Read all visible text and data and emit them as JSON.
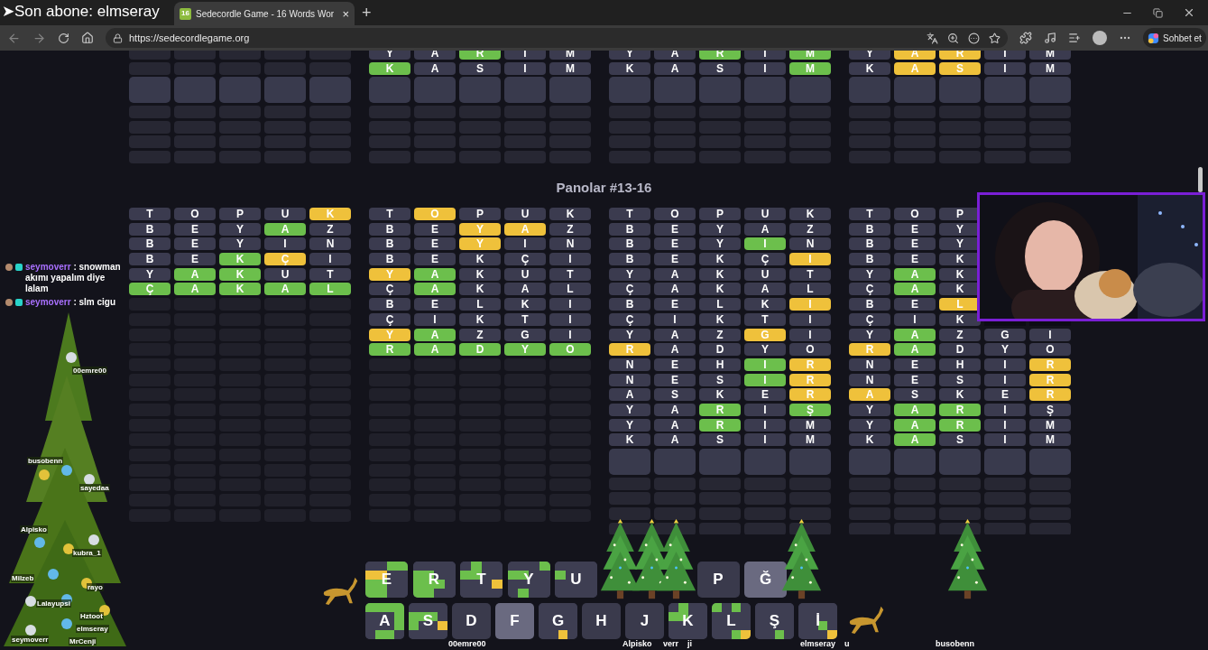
{
  "overlay": {
    "arrow": "➤",
    "text": "Son abone: elmseray"
  },
  "browser": {
    "tabs": [
      {
        "icon": "16",
        "title": "Sedecordle Game - 16 Words Wor",
        "close": "×",
        "selected": true
      }
    ],
    "new_tab": "+",
    "url": "https://sedecordlegame.org",
    "copilot": "Sohbet et"
  },
  "top_boards": [
    {
      "solved": false
    },
    {
      "solved": false,
      "rows": [
        [
          {
            "letter": "Y",
            "color": "#3b3b4f"
          },
          {
            "letter": "A",
            "color": "#3b3b4f"
          },
          {
            "letter": "R",
            "color": "#6cbf4c"
          },
          {
            "letter": "I",
            "color": "#3b3b4f"
          },
          {
            "letter": "M",
            "color": "#3b3b4f"
          }
        ],
        [
          {
            "letter": "K",
            "color": "#6cbf4c"
          },
          {
            "letter": "A",
            "color": "#3b3b4f"
          },
          {
            "letter": "S",
            "color": "#3b3b4f"
          },
          {
            "letter": "I",
            "color": "#3b3b4f"
          },
          {
            "letter": "M",
            "color": "#3b3b4f"
          }
        ]
      ]
    },
    {
      "solved": false,
      "rows": [
        [
          {
            "letter": "Y",
            "color": "#3b3b4f"
          },
          {
            "letter": "A",
            "color": "#3b3b4f"
          },
          {
            "letter": "R",
            "color": "#6cbf4c"
          },
          {
            "letter": "I",
            "color": "#3b3b4f"
          },
          {
            "letter": "M",
            "color": "#6cbf4c"
          }
        ],
        [
          {
            "letter": "K",
            "color": "#3b3b4f"
          },
          {
            "letter": "A",
            "color": "#3b3b4f"
          },
          {
            "letter": "S",
            "color": "#3b3b4f"
          },
          {
            "letter": "I",
            "color": "#3b3b4f"
          },
          {
            "letter": "M",
            "color": "#6cbf4c"
          }
        ]
      ]
    },
    {
      "solved": false,
      "rows": [
        [
          {
            "letter": "Y",
            "color": "#3b3b4f"
          },
          {
            "letter": "A",
            "color": "#efc13b"
          },
          {
            "letter": "R",
            "color": "#efc13b"
          },
          {
            "letter": "I",
            "color": "#3b3b4f"
          },
          {
            "letter": "M",
            "color": "#3b3b4f"
          }
        ],
        [
          {
            "letter": "K",
            "color": "#3b3b4f"
          },
          {
            "letter": "A",
            "color": "#efc13b"
          },
          {
            "letter": "S",
            "color": "#efc13b"
          },
          {
            "letter": "I",
            "color": "#3b3b4f"
          },
          {
            "letter": "M",
            "color": "#3b3b4f"
          }
        ]
      ]
    }
  ],
  "heading": "Panolar #13-16",
  "boards": [
    {
      "solved": true,
      "rows": [
        [
          {
            "letter": "T",
            "color": "#3b3b4f"
          },
          {
            "letter": "O",
            "color": "#3b3b4f"
          },
          {
            "letter": "P",
            "color": "#3b3b4f"
          },
          {
            "letter": "U",
            "color": "#3b3b4f"
          },
          {
            "letter": "K",
            "color": "#efc13b"
          }
        ],
        [
          {
            "letter": "B",
            "color": "#3b3b4f"
          },
          {
            "letter": "E",
            "color": "#3b3b4f"
          },
          {
            "letter": "Y",
            "color": "#3b3b4f"
          },
          {
            "letter": "A",
            "color": "#6cbf4c"
          },
          {
            "letter": "Z",
            "color": "#3b3b4f"
          }
        ],
        [
          {
            "letter": "B",
            "color": "#3b3b4f"
          },
          {
            "letter": "E",
            "color": "#3b3b4f"
          },
          {
            "letter": "Y",
            "color": "#3b3b4f"
          },
          {
            "letter": "I",
            "color": "#3b3b4f"
          },
          {
            "letter": "N",
            "color": "#3b3b4f"
          }
        ],
        [
          {
            "letter": "B",
            "color": "#3b3b4f"
          },
          {
            "letter": "E",
            "color": "#3b3b4f"
          },
          {
            "letter": "K",
            "color": "#6cbf4c"
          },
          {
            "letter": "Ç",
            "color": "#efc13b"
          },
          {
            "letter": "I",
            "color": "#3b3b4f"
          }
        ],
        [
          {
            "letter": "Y",
            "color": "#3b3b4f"
          },
          {
            "letter": "A",
            "color": "#6cbf4c"
          },
          {
            "letter": "K",
            "color": "#6cbf4c"
          },
          {
            "letter": "U",
            "color": "#3b3b4f"
          },
          {
            "letter": "T",
            "color": "#3b3b4f"
          }
        ],
        [
          {
            "letter": "Ç",
            "color": "#6cbf4c"
          },
          {
            "letter": "A",
            "color": "#6cbf4c"
          },
          {
            "letter": "K",
            "color": "#6cbf4c"
          },
          {
            "letter": "A",
            "color": "#6cbf4c"
          },
          {
            "letter": "L",
            "color": "#6cbf4c"
          }
        ]
      ]
    },
    {
      "solved": true,
      "rows": [
        [
          {
            "letter": "T",
            "color": "#3b3b4f"
          },
          {
            "letter": "O",
            "color": "#efc13b"
          },
          {
            "letter": "P",
            "color": "#3b3b4f"
          },
          {
            "letter": "U",
            "color": "#3b3b4f"
          },
          {
            "letter": "K",
            "color": "#3b3b4f"
          }
        ],
        [
          {
            "letter": "B",
            "color": "#3b3b4f"
          },
          {
            "letter": "E",
            "color": "#3b3b4f"
          },
          {
            "letter": "Y",
            "color": "#efc13b"
          },
          {
            "letter": "A",
            "color": "#efc13b"
          },
          {
            "letter": "Z",
            "color": "#3b3b4f"
          }
        ],
        [
          {
            "letter": "B",
            "color": "#3b3b4f"
          },
          {
            "letter": "E",
            "color": "#3b3b4f"
          },
          {
            "letter": "Y",
            "color": "#efc13b"
          },
          {
            "letter": "I",
            "color": "#3b3b4f"
          },
          {
            "letter": "N",
            "color": "#3b3b4f"
          }
        ],
        [
          {
            "letter": "B",
            "color": "#3b3b4f"
          },
          {
            "letter": "E",
            "color": "#3b3b4f"
          },
          {
            "letter": "K",
            "color": "#3b3b4f"
          },
          {
            "letter": "Ç",
            "color": "#3b3b4f"
          },
          {
            "letter": "I",
            "color": "#3b3b4f"
          }
        ],
        [
          {
            "letter": "Y",
            "color": "#efc13b"
          },
          {
            "letter": "A",
            "color": "#6cbf4c"
          },
          {
            "letter": "K",
            "color": "#3b3b4f"
          },
          {
            "letter": "U",
            "color": "#3b3b4f"
          },
          {
            "letter": "T",
            "color": "#3b3b4f"
          }
        ],
        [
          {
            "letter": "Ç",
            "color": "#3b3b4f"
          },
          {
            "letter": "A",
            "color": "#6cbf4c"
          },
          {
            "letter": "K",
            "color": "#3b3b4f"
          },
          {
            "letter": "A",
            "color": "#3b3b4f"
          },
          {
            "letter": "L",
            "color": "#3b3b4f"
          }
        ],
        [
          {
            "letter": "B",
            "color": "#3b3b4f"
          },
          {
            "letter": "E",
            "color": "#3b3b4f"
          },
          {
            "letter": "L",
            "color": "#3b3b4f"
          },
          {
            "letter": "K",
            "color": "#3b3b4f"
          },
          {
            "letter": "I",
            "color": "#3b3b4f"
          }
        ],
        [
          {
            "letter": "Ç",
            "color": "#3b3b4f"
          },
          {
            "letter": "I",
            "color": "#3b3b4f"
          },
          {
            "letter": "K",
            "color": "#3b3b4f"
          },
          {
            "letter": "T",
            "color": "#3b3b4f"
          },
          {
            "letter": "I",
            "color": "#3b3b4f"
          }
        ],
        [
          {
            "letter": "Y",
            "color": "#efc13b"
          },
          {
            "letter": "A",
            "color": "#6cbf4c"
          },
          {
            "letter": "Z",
            "color": "#3b3b4f"
          },
          {
            "letter": "G",
            "color": "#3b3b4f"
          },
          {
            "letter": "I",
            "color": "#3b3b4f"
          }
        ],
        [
          {
            "letter": "R",
            "color": "#6cbf4c"
          },
          {
            "letter": "A",
            "color": "#6cbf4c"
          },
          {
            "letter": "D",
            "color": "#6cbf4c"
          },
          {
            "letter": "Y",
            "color": "#6cbf4c"
          },
          {
            "letter": "O",
            "color": "#6cbf4c"
          }
        ]
      ]
    },
    {
      "solved": false,
      "rows": [
        [
          {
            "letter": "T",
            "color": "#3b3b4f"
          },
          {
            "letter": "O",
            "color": "#3b3b4f"
          },
          {
            "letter": "P",
            "color": "#3b3b4f"
          },
          {
            "letter": "U",
            "color": "#3b3b4f"
          },
          {
            "letter": "K",
            "color": "#3b3b4f"
          }
        ],
        [
          {
            "letter": "B",
            "color": "#3b3b4f"
          },
          {
            "letter": "E",
            "color": "#3b3b4f"
          },
          {
            "letter": "Y",
            "color": "#3b3b4f"
          },
          {
            "letter": "A",
            "color": "#3b3b4f"
          },
          {
            "letter": "Z",
            "color": "#3b3b4f"
          }
        ],
        [
          {
            "letter": "B",
            "color": "#3b3b4f"
          },
          {
            "letter": "E",
            "color": "#3b3b4f"
          },
          {
            "letter": "Y",
            "color": "#3b3b4f"
          },
          {
            "letter": "I",
            "color": "#6cbf4c"
          },
          {
            "letter": "N",
            "color": "#3b3b4f"
          }
        ],
        [
          {
            "letter": "B",
            "color": "#3b3b4f"
          },
          {
            "letter": "E",
            "color": "#3b3b4f"
          },
          {
            "letter": "K",
            "color": "#3b3b4f"
          },
          {
            "letter": "Ç",
            "color": "#3b3b4f"
          },
          {
            "letter": "I",
            "color": "#efc13b"
          }
        ],
        [
          {
            "letter": "Y",
            "color": "#3b3b4f"
          },
          {
            "letter": "A",
            "color": "#3b3b4f"
          },
          {
            "letter": "K",
            "color": "#3b3b4f"
          },
          {
            "letter": "U",
            "color": "#3b3b4f"
          },
          {
            "letter": "T",
            "color": "#3b3b4f"
          }
        ],
        [
          {
            "letter": "Ç",
            "color": "#3b3b4f"
          },
          {
            "letter": "A",
            "color": "#3b3b4f"
          },
          {
            "letter": "K",
            "color": "#3b3b4f"
          },
          {
            "letter": "A",
            "color": "#3b3b4f"
          },
          {
            "letter": "L",
            "color": "#3b3b4f"
          }
        ],
        [
          {
            "letter": "B",
            "color": "#3b3b4f"
          },
          {
            "letter": "E",
            "color": "#3b3b4f"
          },
          {
            "letter": "L",
            "color": "#3b3b4f"
          },
          {
            "letter": "K",
            "color": "#3b3b4f"
          },
          {
            "letter": "I",
            "color": "#efc13b"
          }
        ],
        [
          {
            "letter": "Ç",
            "color": "#3b3b4f"
          },
          {
            "letter": "I",
            "color": "#3b3b4f"
          },
          {
            "letter": "K",
            "color": "#3b3b4f"
          },
          {
            "letter": "T",
            "color": "#3b3b4f"
          },
          {
            "letter": "I",
            "color": "#3b3b4f"
          }
        ],
        [
          {
            "letter": "Y",
            "color": "#3b3b4f"
          },
          {
            "letter": "A",
            "color": "#3b3b4f"
          },
          {
            "letter": "Z",
            "color": "#3b3b4f"
          },
          {
            "letter": "G",
            "color": "#efc13b"
          },
          {
            "letter": "I",
            "color": "#3b3b4f"
          }
        ],
        [
          {
            "letter": "R",
            "color": "#efc13b"
          },
          {
            "letter": "A",
            "color": "#3b3b4f"
          },
          {
            "letter": "D",
            "color": "#3b3b4f"
          },
          {
            "letter": "Y",
            "color": "#3b3b4f"
          },
          {
            "letter": "O",
            "color": "#3b3b4f"
          }
        ],
        [
          {
            "letter": "N",
            "color": "#3b3b4f"
          },
          {
            "letter": "E",
            "color": "#3b3b4f"
          },
          {
            "letter": "H",
            "color": "#3b3b4f"
          },
          {
            "letter": "I",
            "color": "#6cbf4c"
          },
          {
            "letter": "R",
            "color": "#efc13b"
          }
        ],
        [
          {
            "letter": "N",
            "color": "#3b3b4f"
          },
          {
            "letter": "E",
            "color": "#3b3b4f"
          },
          {
            "letter": "S",
            "color": "#3b3b4f"
          },
          {
            "letter": "I",
            "color": "#6cbf4c"
          },
          {
            "letter": "R",
            "color": "#efc13b"
          }
        ],
        [
          {
            "letter": "A",
            "color": "#3b3b4f"
          },
          {
            "letter": "S",
            "color": "#3b3b4f"
          },
          {
            "letter": "K",
            "color": "#3b3b4f"
          },
          {
            "letter": "E",
            "color": "#3b3b4f"
          },
          {
            "letter": "R",
            "color": "#efc13b"
          }
        ],
        [
          {
            "letter": "Y",
            "color": "#3b3b4f"
          },
          {
            "letter": "A",
            "color": "#3b3b4f"
          },
          {
            "letter": "R",
            "color": "#6cbf4c"
          },
          {
            "letter": "I",
            "color": "#3b3b4f"
          },
          {
            "letter": "Ş",
            "color": "#6cbf4c"
          }
        ],
        [
          {
            "letter": "Y",
            "color": "#3b3b4f"
          },
          {
            "letter": "A",
            "color": "#3b3b4f"
          },
          {
            "letter": "R",
            "color": "#6cbf4c"
          },
          {
            "letter": "I",
            "color": "#3b3b4f"
          },
          {
            "letter": "M",
            "color": "#3b3b4f"
          }
        ],
        [
          {
            "letter": "K",
            "color": "#3b3b4f"
          },
          {
            "letter": "A",
            "color": "#3b3b4f"
          },
          {
            "letter": "S",
            "color": "#3b3b4f"
          },
          {
            "letter": "I",
            "color": "#3b3b4f"
          },
          {
            "letter": "M",
            "color": "#3b3b4f"
          }
        ]
      ]
    },
    {
      "solved": false,
      "rows": [
        [
          {
            "letter": "T",
            "color": "#3b3b4f"
          },
          {
            "letter": "O",
            "color": "#3b3b4f"
          },
          {
            "letter": "P",
            "color": "#3b3b4f"
          }
        ],
        [
          {
            "letter": "B",
            "color": "#3b3b4f"
          },
          {
            "letter": "E",
            "color": "#3b3b4f"
          },
          {
            "letter": "Y",
            "color": "#3b3b4f"
          }
        ],
        [
          {
            "letter": "B",
            "color": "#3b3b4f"
          },
          {
            "letter": "E",
            "color": "#3b3b4f"
          },
          {
            "letter": "Y",
            "color": "#3b3b4f"
          }
        ],
        [
          {
            "letter": "B",
            "color": "#3b3b4f"
          },
          {
            "letter": "E",
            "color": "#3b3b4f"
          },
          {
            "letter": "K",
            "color": "#3b3b4f"
          }
        ],
        [
          {
            "letter": "Y",
            "color": "#3b3b4f"
          },
          {
            "letter": "A",
            "color": "#6cbf4c"
          },
          {
            "letter": "K",
            "color": "#3b3b4f"
          }
        ],
        [
          {
            "letter": "Ç",
            "color": "#3b3b4f"
          },
          {
            "letter": "A",
            "color": "#6cbf4c"
          },
          {
            "letter": "K",
            "color": "#3b3b4f"
          }
        ],
        [
          {
            "letter": "B",
            "color": "#3b3b4f"
          },
          {
            "letter": "E",
            "color": "#3b3b4f"
          },
          {
            "letter": "L",
            "color": "#efc13b"
          }
        ],
        [
          {
            "letter": "Ç",
            "color": "#3b3b4f"
          },
          {
            "letter": "I",
            "color": "#3b3b4f"
          },
          {
            "letter": "K",
            "color": "#3b3b4f"
          }
        ],
        [
          {
            "letter": "Y",
            "color": "#3b3b4f"
          },
          {
            "letter": "A",
            "color": "#6cbf4c"
          },
          {
            "letter": "Z",
            "color": "#3b3b4f"
          },
          {
            "letter": "G",
            "color": "#3b3b4f"
          },
          {
            "letter": "I",
            "color": "#3b3b4f"
          }
        ],
        [
          {
            "letter": "R",
            "color": "#efc13b"
          },
          {
            "letter": "A",
            "color": "#6cbf4c"
          },
          {
            "letter": "D",
            "color": "#3b3b4f"
          },
          {
            "letter": "Y",
            "color": "#3b3b4f"
          },
          {
            "letter": "O",
            "color": "#3b3b4f"
          }
        ],
        [
          {
            "letter": "N",
            "color": "#3b3b4f"
          },
          {
            "letter": "E",
            "color": "#3b3b4f"
          },
          {
            "letter": "H",
            "color": "#3b3b4f"
          },
          {
            "letter": "I",
            "color": "#3b3b4f"
          },
          {
            "letter": "R",
            "color": "#efc13b"
          }
        ],
        [
          {
            "letter": "N",
            "color": "#3b3b4f"
          },
          {
            "letter": "E",
            "color": "#3b3b4f"
          },
          {
            "letter": "S",
            "color": "#3b3b4f"
          },
          {
            "letter": "I",
            "color": "#3b3b4f"
          },
          {
            "letter": "R",
            "color": "#efc13b"
          }
        ],
        [
          {
            "letter": "A",
            "color": "#efc13b"
          },
          {
            "letter": "S",
            "color": "#3b3b4f"
          },
          {
            "letter": "K",
            "color": "#3b3b4f"
          },
          {
            "letter": "E",
            "color": "#3b3b4f"
          },
          {
            "letter": "R",
            "color": "#efc13b"
          }
        ],
        [
          {
            "letter": "Y",
            "color": "#3b3b4f"
          },
          {
            "letter": "A",
            "color": "#6cbf4c"
          },
          {
            "letter": "R",
            "color": "#6cbf4c"
          },
          {
            "letter": "I",
            "color": "#3b3b4f"
          },
          {
            "letter": "Ş",
            "color": "#3b3b4f"
          }
        ],
        [
          {
            "letter": "Y",
            "color": "#3b3b4f"
          },
          {
            "letter": "A",
            "color": "#6cbf4c"
          },
          {
            "letter": "R",
            "color": "#6cbf4c"
          },
          {
            "letter": "I",
            "color": "#3b3b4f"
          },
          {
            "letter": "M",
            "color": "#3b3b4f"
          }
        ],
        [
          {
            "letter": "K",
            "color": "#3b3b4f"
          },
          {
            "letter": "A",
            "color": "#6cbf4c"
          },
          {
            "letter": "S",
            "color": "#3b3b4f"
          },
          {
            "letter": "I",
            "color": "#3b3b4f"
          },
          {
            "letter": "M",
            "color": "#3b3b4f"
          }
        ]
      ]
    }
  ],
  "chat": [
    {
      "user": "seymoverr",
      "message": ": snowman akımı yapalım diye lalam"
    },
    {
      "user": "seymoverr",
      "message": ": slm cigu"
    }
  ],
  "keyboard": [
    [
      {
        "label": "E",
        "kind": "mixed",
        "patches": [
          {
            "color": "#3e3e52"
          },
          {
            "color": "#3e3e52"
          },
          {
            "color": "#6cbf4c"
          },
          {
            "color": "#6cbf4c"
          },
          {
            "color": "#efc13b"
          },
          {
            "color": "#efc13b"
          },
          {
            "color": "#3e3e52"
          },
          {
            "color": "#3e3e52"
          },
          {
            "color": "#6cbf4c"
          },
          {
            "color": "#6cbf4c"
          },
          {
            "color": "#3e3e52"
          },
          {
            "color": "#3e3e52"
          },
          {
            "color": "#6cbf4c"
          },
          {
            "color": "#6cbf4c"
          },
          {
            "color": "#3e3e52"
          },
          {
            "color": "#3e3e52"
          }
        ]
      },
      {
        "label": "R",
        "kind": "mixed",
        "patches": [
          {
            "color": "#3e3e52"
          },
          {
            "color": "#3e3e52"
          },
          {
            "color": "#3e3e52"
          },
          {
            "color": "#3e3e52"
          },
          {
            "color": "#6cbf4c"
          },
          {
            "color": "#6cbf4c"
          },
          {
            "color": "#3e3e52"
          },
          {
            "color": "#3e3e52"
          },
          {
            "color": "#6cbf4c"
          },
          {
            "color": "#6cbf4c"
          },
          {
            "color": "#6cbf4c"
          },
          {
            "color": "#3e3e52"
          },
          {
            "color": "#6cbf4c"
          },
          {
            "color": "#6cbf4c"
          },
          {
            "color": "#3e3e52"
          },
          {
            "color": "#3e3e52"
          }
        ]
      },
      {
        "label": "T",
        "kind": "mixed",
        "patches": [
          {
            "color": "#3e3e52"
          },
          {
            "color": "#6cbf4c"
          },
          {
            "color": "#3e3e52"
          },
          {
            "color": "#3e3e52"
          },
          {
            "color": "#6cbf4c"
          },
          {
            "color": "#6cbf4c"
          },
          {
            "color": "#3e3e52"
          },
          {
            "color": "#3e3e52"
          },
          {
            "color": "#3e3e52"
          },
          {
            "color": "#3e3e52"
          },
          {
            "color": "#3e3e52"
          },
          {
            "color": "#efc13b"
          },
          {
            "color": "#3e3e52"
          },
          {
            "color": "#3e3e52"
          },
          {
            "color": "#3e3e52"
          },
          {
            "color": "#3e3e52"
          }
        ]
      },
      {
        "label": "Y",
        "kind": "mixed",
        "patches": [
          {
            "color": "#3e3e52"
          },
          {
            "color": "#3e3e52"
          },
          {
            "color": "#3e3e52"
          },
          {
            "color": "#6cbf4c"
          },
          {
            "color": "#6cbf4c"
          },
          {
            "color": "#6cbf4c"
          },
          {
            "color": "#3e3e52"
          },
          {
            "color": "#3e3e52"
          },
          {
            "color": "#3e3e52"
          },
          {
            "color": "#3e3e52"
          },
          {
            "color": "#3e3e52"
          },
          {
            "color": "#3e3e52"
          },
          {
            "color": "#3e3e52"
          },
          {
            "color": "#6cbf4c"
          },
          {
            "color": "#3e3e52"
          },
          {
            "color": "#3e3e52"
          }
        ]
      },
      {
        "label": "U",
        "kind": "mixed",
        "patches": [
          {
            "color": "#3e3e52"
          },
          {
            "color": "#3e3e52"
          },
          {
            "color": "#3e3e52"
          },
          {
            "color": "#3e3e52"
          },
          {
            "color": "#6cbf4c"
          },
          {
            "color": "#3e3e52"
          },
          {
            "color": "#3e3e52"
          },
          {
            "color": "#3e3e52"
          },
          {
            "color": "#3e3e52"
          },
          {
            "color": "#3e3e52"
          },
          {
            "color": "#3e3e52"
          },
          {
            "color": "#3e3e52"
          },
          {
            "color": "#3e3e52"
          },
          {
            "color": "#3e3e52"
          },
          {
            "color": "#3e3e52"
          },
          {
            "color": "#3e3e52"
          }
        ]
      },
      {
        "kind": "covered"
      },
      {
        "kind": "covered"
      },
      {
        "label": "P",
        "kind": "absent"
      },
      {
        "label": "Ğ",
        "kind": "unused"
      },
      {
        "kind": "covered"
      }
    ],
    [
      {
        "label": "A",
        "kind": "mixed",
        "patches": [
          {
            "color": "#6cbf4c"
          },
          {
            "color": "#6cbf4c"
          },
          {
            "color": "#6cbf4c"
          },
          {
            "color": "#6cbf4c"
          },
          {
            "color": "#3e3e52"
          },
          {
            "color": "#3e3e52"
          },
          {
            "color": "#3e3e52"
          },
          {
            "color": "#6cbf4c"
          },
          {
            "color": "#3e3e52"
          },
          {
            "color": "#3e3e52"
          },
          {
            "color": "#3e3e52"
          },
          {
            "color": "#6cbf4c"
          },
          {
            "color": "#3e3e52"
          },
          {
            "color": "#6cbf4c"
          },
          {
            "color": "#6cbf4c"
          },
          {
            "color": "#3e3e52"
          }
        ]
      },
      {
        "label": "S",
        "kind": "mixed",
        "patches": [
          {
            "color": "#3e3e52"
          },
          {
            "color": "#3e3e52"
          },
          {
            "color": "#3e3e52"
          },
          {
            "color": "#3e3e52"
          },
          {
            "color": "#6cbf4c"
          },
          {
            "color": "#6cbf4c"
          },
          {
            "color": "#6cbf4c"
          },
          {
            "color": "#3e3e52"
          },
          {
            "color": "#6cbf4c"
          },
          {
            "color": "#3e3e52"
          },
          {
            "color": "#3e3e52"
          },
          {
            "color": "#efc13b"
          },
          {
            "color": "#3e3e52"
          },
          {
            "color": "#3e3e52"
          },
          {
            "color": "#3e3e52"
          },
          {
            "color": "#3e3e52"
          }
        ]
      },
      {
        "label": "D",
        "kind": "absent"
      },
      {
        "label": "F",
        "kind": "unused"
      },
      {
        "label": "G",
        "kind": "mixed",
        "patches": [
          {
            "color": "#3e3e52"
          },
          {
            "color": "#3e3e52"
          },
          {
            "color": "#3e3e52"
          },
          {
            "color": "#3e3e52"
          },
          {
            "color": "#3e3e52"
          },
          {
            "color": "#3e3e52"
          },
          {
            "color": "#3e3e52"
          },
          {
            "color": "#3e3e52"
          },
          {
            "color": "#3e3e52"
          },
          {
            "color": "#3e3e52"
          },
          {
            "color": "#3e3e52"
          },
          {
            "color": "#3e3e52"
          },
          {
            "color": "#3e3e52"
          },
          {
            "color": "#3e3e52"
          },
          {
            "color": "#efc13b"
          },
          {
            "color": "#3e3e52"
          }
        ]
      },
      {
        "label": "H",
        "kind": "absent"
      },
      {
        "label": "J",
        "kind": "absent"
      },
      {
        "label": "K",
        "kind": "mixed",
        "patches": [
          {
            "color": "#3e3e52"
          },
          {
            "color": "#6cbf4c"
          },
          {
            "color": "#3e3e52"
          },
          {
            "color": "#3e3e52"
          },
          {
            "color": "#6cbf4c"
          },
          {
            "color": "#6cbf4c"
          },
          {
            "color": "#3e3e52"
          },
          {
            "color": "#3e3e52"
          },
          {
            "color": "#3e3e52"
          },
          {
            "color": "#3e3e52"
          },
          {
            "color": "#3e3e52"
          },
          {
            "color": "#3e3e52"
          },
          {
            "color": "#3e3e52"
          },
          {
            "color": "#3e3e52"
          },
          {
            "color": "#3e3e52"
          },
          {
            "color": "#3e3e52"
          }
        ]
      },
      {
        "label": "L",
        "kind": "mixed",
        "patches": [
          {
            "color": "#6cbf4c"
          },
          {
            "color": "#3e3e52"
          },
          {
            "color": "#6cbf4c"
          },
          {
            "color": "#3e3e52"
          },
          {
            "color": "#3e3e52"
          },
          {
            "color": "#3e3e52"
          },
          {
            "color": "#3e3e52"
          },
          {
            "color": "#3e3e52"
          },
          {
            "color": "#3e3e52"
          },
          {
            "color": "#3e3e52"
          },
          {
            "color": "#3e3e52"
          },
          {
            "color": "#3e3e52"
          },
          {
            "color": "#3e3e52"
          },
          {
            "color": "#3e3e52"
          },
          {
            "color": "#6cbf4c"
          },
          {
            "color": "#efc13b"
          }
        ]
      },
      {
        "label": "Ş",
        "kind": "mixed",
        "patches": [
          {
            "color": "#3e3e52"
          },
          {
            "color": "#3e3e52"
          },
          {
            "color": "#3e3e52"
          },
          {
            "color": "#3e3e52"
          },
          {
            "color": "#3e3e52"
          },
          {
            "color": "#3e3e52"
          },
          {
            "color": "#3e3e52"
          },
          {
            "color": "#3e3e52"
          },
          {
            "color": "#3e3e52"
          },
          {
            "color": "#3e3e52"
          },
          {
            "color": "#3e3e52"
          },
          {
            "color": "#3e3e52"
          },
          {
            "color": "#3e3e52"
          },
          {
            "color": "#3e3e52"
          },
          {
            "color": "#6cbf4c"
          },
          {
            "color": "#3e3e52"
          }
        ]
      },
      {
        "label": "İ",
        "kind": "mixed",
        "patches": [
          {
            "color": "#3e3e52"
          },
          {
            "color": "#3e3e52"
          },
          {
            "color": "#3e3e52"
          },
          {
            "color": "#3e3e52"
          },
          {
            "color": "#3e3e52"
          },
          {
            "color": "#3e3e52"
          },
          {
            "color": "#3e3e52"
          },
          {
            "color": "#3e3e52"
          },
          {
            "color": "#3e3e52"
          },
          {
            "color": "#3e3e52"
          },
          {
            "color": "#6cbf4c"
          },
          {
            "color": "#3e3e52"
          },
          {
            "color": "#3e3e52"
          },
          {
            "color": "#3e3e52"
          },
          {
            "color": "#3e3e52"
          },
          {
            "color": "#efc13b"
          }
        ]
      }
    ]
  ],
  "tree_names": [
    "00emre00",
    "busobenn",
    "sayedaa",
    "Alpisko",
    "kubra_1",
    "Milzeb",
    "rayo",
    "Lalayupsi",
    "Hztoot",
    "elmseray",
    "seymoverr",
    "MrCenji"
  ],
  "walker_names": [
    "00emre00",
    "Alpisko",
    "verr",
    "ji",
    "elmseray",
    "u",
    "busobenn"
  ]
}
